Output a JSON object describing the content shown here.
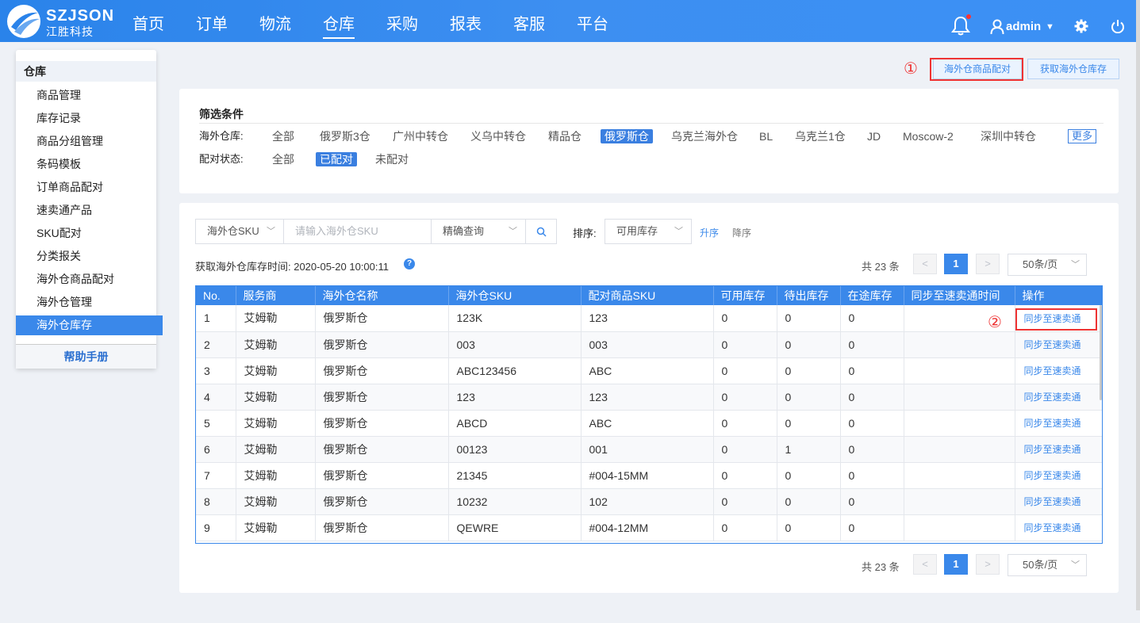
{
  "brand": {
    "name": "SZJSON",
    "sub": "江胜科技"
  },
  "nav": [
    "首页",
    "订单",
    "物流",
    "仓库",
    "采购",
    "报表",
    "客服",
    "平台"
  ],
  "nav_active": "仓库",
  "user": {
    "name": "admin"
  },
  "sidebar": {
    "title": "仓库",
    "items": [
      "商品管理",
      "库存记录",
      "商品分组管理",
      "条码模板",
      "订单商品配对",
      "速卖通产品",
      "SKU配对",
      "分类报关",
      "海外仓商品配对",
      "海外仓管理",
      "海外仓库存"
    ],
    "active": "海外仓库存",
    "help": "帮助手册"
  },
  "top_buttons": {
    "pair": "海外仓商品配对",
    "fetch": "获取海外仓库存"
  },
  "markers": {
    "one": "①",
    "two": "②"
  },
  "filter": {
    "title": "筛选条件",
    "warehouse_label": "海外仓库:",
    "warehouses": [
      "全部",
      "俄罗斯3仓",
      "广州中转仓",
      "义乌中转仓",
      "精品仓",
      "俄罗斯仓",
      "乌克兰海外仓",
      "BL",
      "乌克兰1仓",
      "JD",
      "Moscow-2",
      "深圳中转仓"
    ],
    "warehouse_selected": "俄罗斯仓",
    "more": "更多",
    "status_label": "配对状态:",
    "statuses": [
      "全部",
      "已配对",
      "未配对"
    ],
    "status_selected": "已配对"
  },
  "search": {
    "field": "海外仓SKU",
    "placeholder": "请输入海外仓SKU",
    "mode": "精确查询",
    "sort_label": "排序:",
    "sort_field": "可用库存",
    "asc": "升序",
    "desc": "降序"
  },
  "fetch_time": "获取海外仓库存时间: 2020-05-20 10:00:11",
  "pagination": {
    "total": "共 23 条",
    "current": "1",
    "prev": "<",
    "next": ">",
    "page_size": "50条/页"
  },
  "table": {
    "headers": [
      "No.",
      "服务商",
      "海外仓名称",
      "海外仓SKU",
      "配对商品SKU",
      "可用库存",
      "待出库存",
      "在途库存",
      "同步至速卖通时间",
      "操作"
    ],
    "action_label": "同步至速卖通",
    "rows": [
      [
        "1",
        "艾姆勒",
        "俄罗斯仓",
        "123K",
        "123",
        "0",
        "0",
        "0",
        ""
      ],
      [
        "2",
        "艾姆勒",
        "俄罗斯仓",
        "003",
        "003",
        "0",
        "0",
        "0",
        ""
      ],
      [
        "3",
        "艾姆勒",
        "俄罗斯仓",
        "ABC123456",
        "ABC",
        "0",
        "0",
        "0",
        ""
      ],
      [
        "4",
        "艾姆勒",
        "俄罗斯仓",
        "123",
        "123",
        "0",
        "0",
        "0",
        ""
      ],
      [
        "5",
        "艾姆勒",
        "俄罗斯仓",
        "ABCD",
        "ABC",
        "0",
        "0",
        "0",
        ""
      ],
      [
        "6",
        "艾姆勒",
        "俄罗斯仓",
        "00123",
        "001",
        "0",
        "1",
        "0",
        ""
      ],
      [
        "7",
        "艾姆勒",
        "俄罗斯仓",
        "21345",
        "#004-15MM",
        "0",
        "0",
        "0",
        ""
      ],
      [
        "8",
        "艾姆勒",
        "俄罗斯仓",
        "10232",
        "102",
        "0",
        "0",
        "0",
        ""
      ],
      [
        "9",
        "艾姆勒",
        "俄罗斯仓",
        "QEWRE",
        "#004-12MM",
        "0",
        "0",
        "0",
        ""
      ]
    ]
  },
  "colors": {
    "primary": "#3a88ea",
    "header_bg": "#3b8cf0",
    "highlight": "#e33333"
  }
}
